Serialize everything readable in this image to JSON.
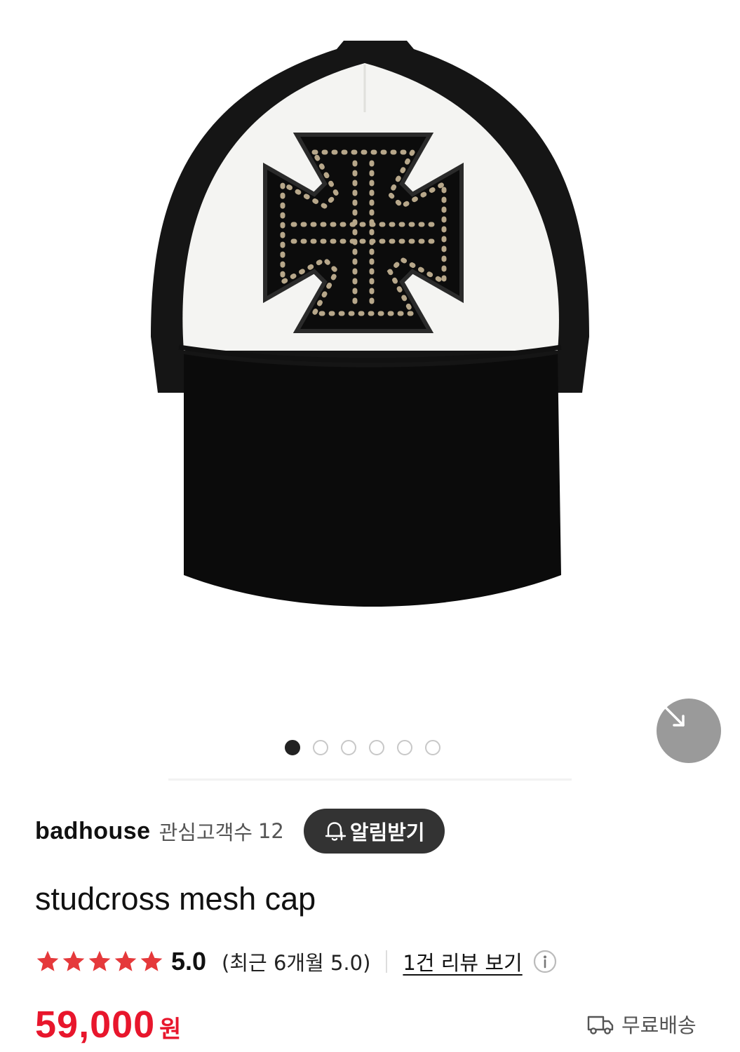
{
  "carousel": {
    "image_alt": "studcross mesh cap",
    "total_slides": 6,
    "active_slide": 1,
    "zoom_icon": "expand-arrows-icon"
  },
  "brand": {
    "name": "badhouse",
    "fans_label": "관심고객수",
    "fans_count": "12",
    "alert_label": "알림받기",
    "alert_icon": "bell-plus-icon"
  },
  "product": {
    "title": "studcross mesh cap"
  },
  "rating": {
    "stars": 5,
    "score": "5.0",
    "recent_text": "(최근 6개월 5.0)",
    "review_link": "1건 리뷰 보기",
    "info_icon": "info-icon",
    "star_color": "#e5393b"
  },
  "price": {
    "amount": "59,000",
    "currency": "원",
    "color": "#e8162c"
  },
  "shipping": {
    "label": "무료배송",
    "icon": "truck-icon"
  }
}
